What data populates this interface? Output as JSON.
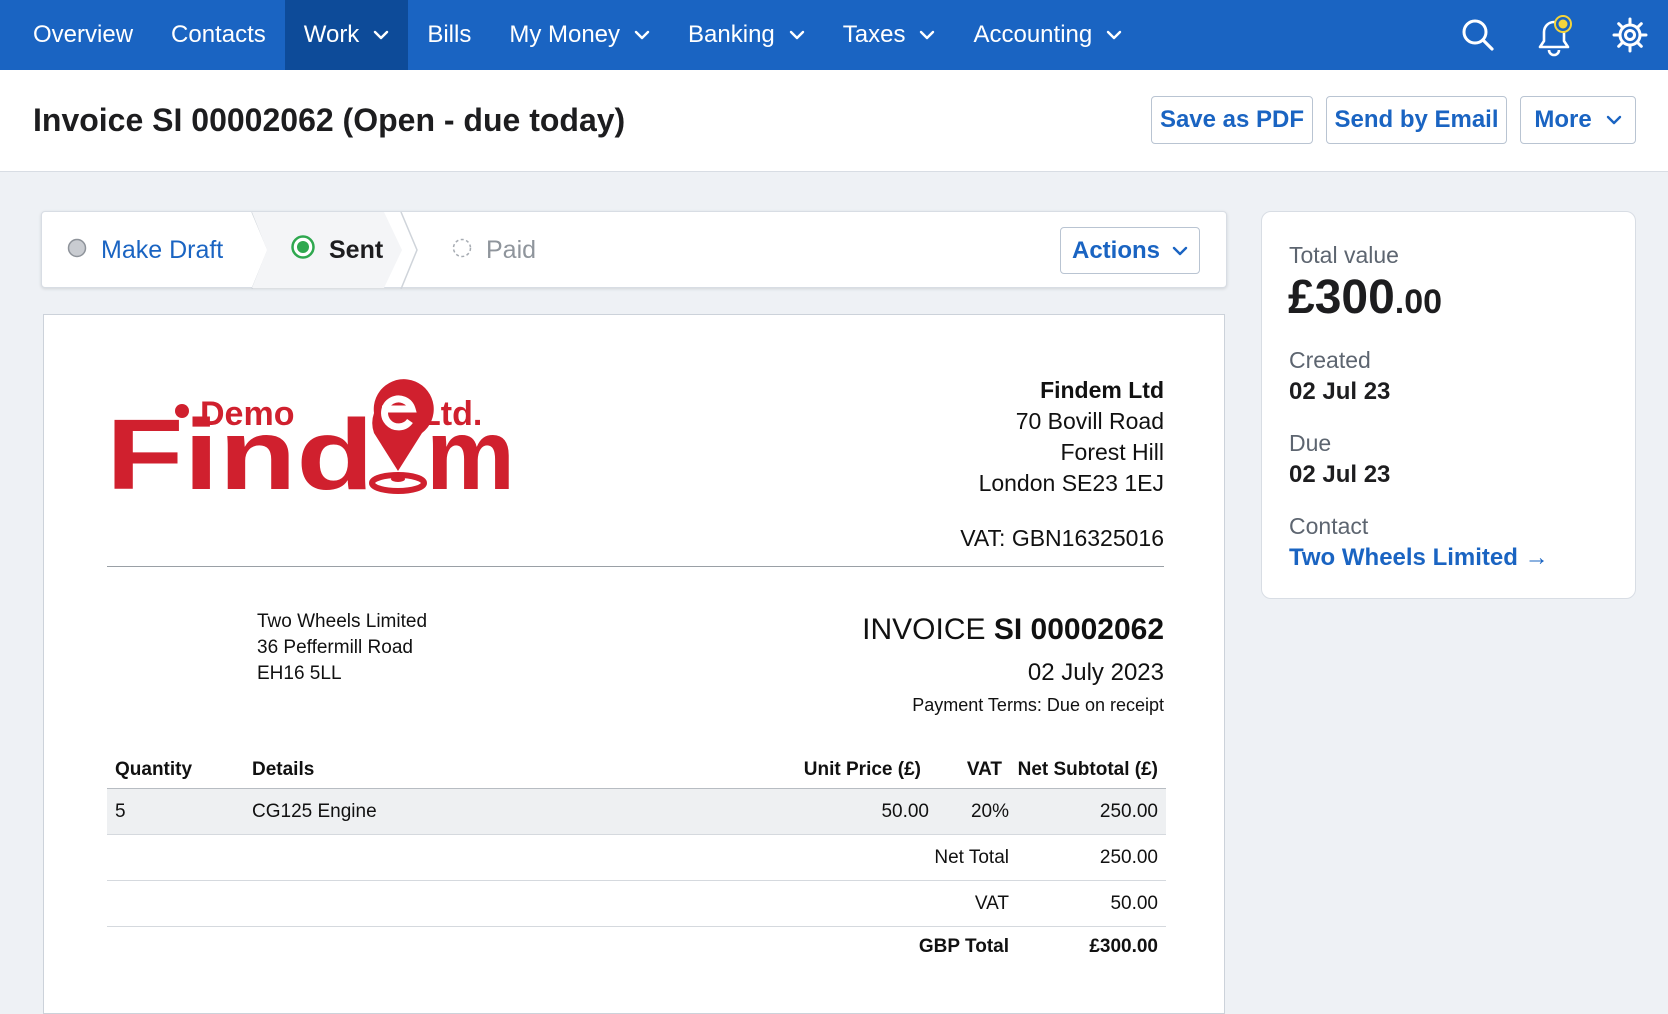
{
  "nav": {
    "items": [
      {
        "label": "Overview",
        "dropdown": false
      },
      {
        "label": "Contacts",
        "dropdown": false
      },
      {
        "label": "Work",
        "dropdown": true,
        "active": true
      },
      {
        "label": "Bills",
        "dropdown": false
      },
      {
        "label": "My Money",
        "dropdown": true
      },
      {
        "label": "Banking",
        "dropdown": true
      },
      {
        "label": "Taxes",
        "dropdown": true
      },
      {
        "label": "Accounting",
        "dropdown": true
      }
    ],
    "icons": [
      "search-icon",
      "bell-icon",
      "gear-icon"
    ],
    "color": "#1a64c2",
    "active_color": "#0d4b99"
  },
  "header": {
    "title": "Invoice SI 00002062 (Open - due today)",
    "save_pdf_label": "Save as PDF",
    "send_email_label": "Send by Email",
    "more_label": "More"
  },
  "status": {
    "steps": [
      {
        "label": "Make Draft",
        "state": "link"
      },
      {
        "label": "Sent",
        "state": "current"
      },
      {
        "label": "Paid",
        "state": "pending"
      }
    ],
    "actions_label": "Actions",
    "current_color": "#2fa84f"
  },
  "invoice": {
    "logo": {
      "demo": "Demo",
      "ltd": "Ltd.",
      "name": "Findem",
      "color": "#d0202e"
    },
    "company": {
      "name": "Findem Ltd",
      "address": [
        "70 Bovill Road",
        "Forest Hill",
        "London SE23 1EJ"
      ],
      "vat": "VAT: GBN16325016"
    },
    "bill_to": [
      "Two Wheels Limited",
      "36 Peffermill Road",
      "EH16 5LL"
    ],
    "title_prefix": "INVOICE",
    "number": "SI 00002062",
    "date": "02 July 2023",
    "terms": "Payment Terms: Due on receipt",
    "headers": {
      "qty": "Quantity",
      "details": "Details",
      "unit": "Unit Price (£)",
      "vat": "VAT",
      "net": "Net Subtotal (£)"
    },
    "line_items": [
      {
        "qty": "5",
        "details": "CG125 Engine",
        "unit": "50.00",
        "vat": "20%",
        "net": "250.00"
      }
    ],
    "totals": [
      {
        "label": "Net Total",
        "value": "250.00",
        "bold": false
      },
      {
        "label": "VAT",
        "value": "50.00",
        "bold": false
      },
      {
        "label": "GBP Total",
        "value": "£300.00",
        "bold": true
      }
    ]
  },
  "summary": {
    "total_label": "Total value",
    "total_major": "£300",
    "total_minor": ".00",
    "created_label": "Created",
    "created_value": "02 Jul 23",
    "due_label": "Due",
    "due_value": "02 Jul 23",
    "contact_label": "Contact",
    "contact_value": "Two Wheels Limited →"
  }
}
